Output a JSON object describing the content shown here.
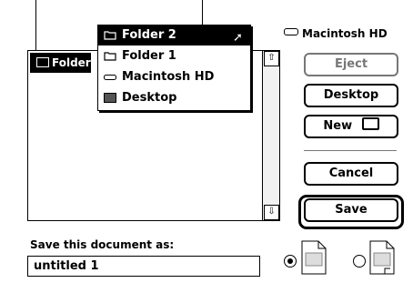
{
  "menu": {
    "items": [
      {
        "label": "Folder 2",
        "icon": "folder-icon",
        "selected": true
      },
      {
        "label": "Folder 1",
        "icon": "folder-icon",
        "selected": false
      },
      {
        "label": "Macintosh HD",
        "icon": "hard-disk-icon",
        "selected": false
      },
      {
        "label": "Desktop",
        "icon": "desktop-icon",
        "selected": false
      }
    ]
  },
  "file_list": {
    "current_folder": "Folder"
  },
  "disk": {
    "label": "Macintosh HD",
    "icon": "hard-disk-icon"
  },
  "buttons": {
    "eject": "Eject",
    "desktop": "Desktop",
    "new_folder": "New",
    "cancel": "Cancel",
    "save": "Save"
  },
  "save_as": {
    "prompt": "Save this document as:",
    "filename": "untitled 1"
  },
  "format_options": {
    "selected": "first"
  }
}
